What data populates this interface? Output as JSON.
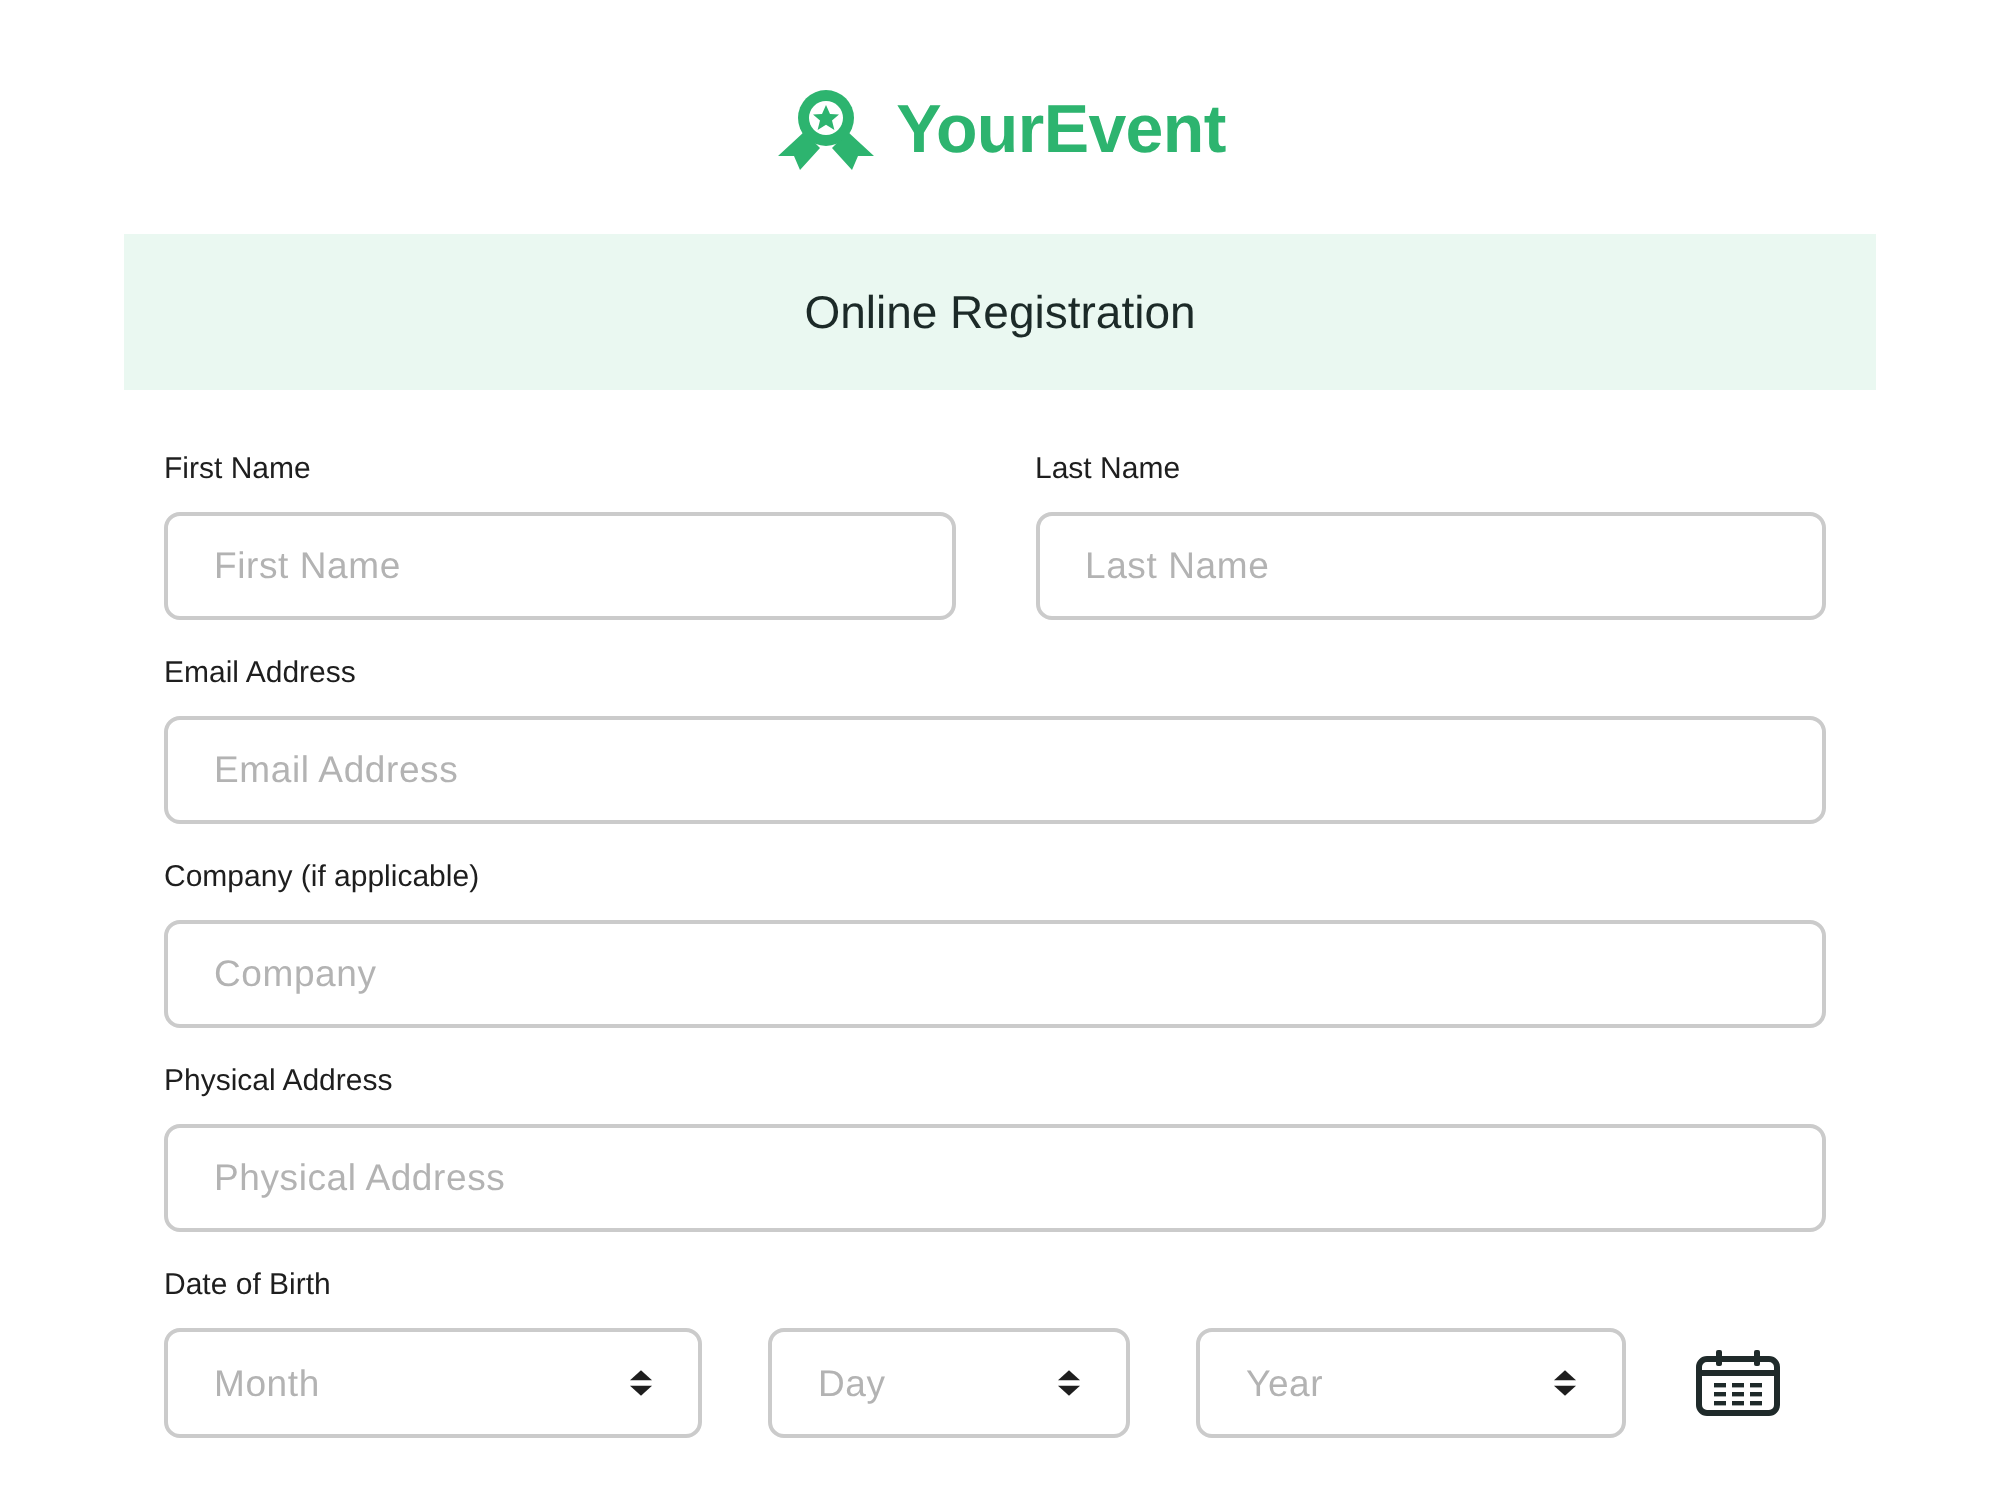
{
  "logo": {
    "name": "YourEvent"
  },
  "header": {
    "title": "Online Registration"
  },
  "form": {
    "rows": [
      {
        "kind": "text",
        "fields": [
          {
            "label": "First Name",
            "placeholder": "First Name"
          },
          {
            "label": "Last Name",
            "placeholder": "Last Name"
          }
        ]
      },
      {
        "kind": "text",
        "fields": [
          {
            "label": "Email Address",
            "placeholder": "Email Address"
          }
        ]
      },
      {
        "kind": "text",
        "fields": [
          {
            "label": "Company (if applicable)",
            "placeholder": "Company"
          }
        ]
      },
      {
        "kind": "text",
        "fields": [
          {
            "label": "Physical Address",
            "placeholder": "Physical Address"
          }
        ]
      },
      {
        "kind": "date",
        "label": "Date of Birth",
        "selects": [
          {
            "placeholder": "Month"
          },
          {
            "placeholder": "Day"
          },
          {
            "placeholder": "Year"
          }
        ]
      }
    ]
  }
}
